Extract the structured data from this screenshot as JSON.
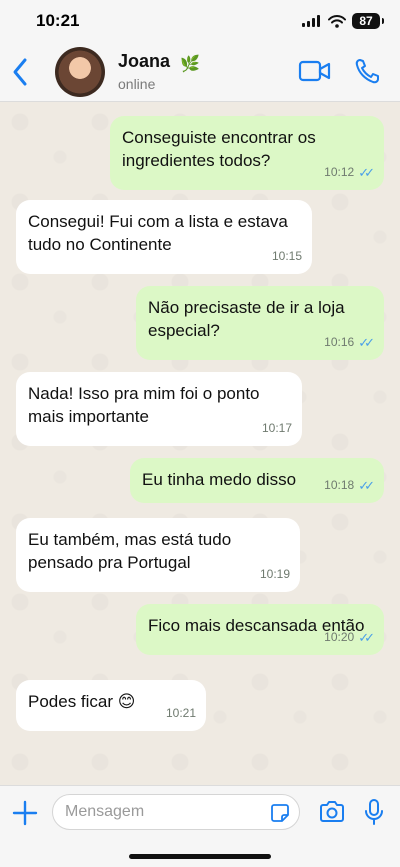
{
  "status_bar": {
    "time": "10:21",
    "battery": "87"
  },
  "header": {
    "contact_name": "Joana",
    "contact_status": "online",
    "name_emoji": "🌿"
  },
  "messages": [
    {
      "direction": "out",
      "text": "Conseguiste encontrar os ingredientes todos?",
      "time": "10:12",
      "read": true
    },
    {
      "direction": "in",
      "text": "Consegui! Fui com a lista e estava tudo no Continente",
      "time": "10:15"
    },
    {
      "direction": "out",
      "text": "Não precisaste de ir a loja especial?",
      "time": "10:16",
      "read": true
    },
    {
      "direction": "in",
      "text": "Nada! Isso pra mim foi o ponto mais importante",
      "time": "10:17"
    },
    {
      "direction": "out",
      "text": "Eu tinha medo disso",
      "time": "10:18",
      "read": true
    },
    {
      "direction": "in",
      "text": "Eu também, mas está tudo pensado pra Portugal",
      "time": "10:19"
    },
    {
      "direction": "out",
      "text": "Fico mais descansada então",
      "time": "10:20",
      "read": true
    },
    {
      "direction": "in",
      "text": "Podes ficar 😊",
      "time": "10:21"
    }
  ],
  "input": {
    "placeholder": "Mensagem"
  },
  "colors": {
    "accent": "#1a7ef0",
    "outgoing_bubble": "#dcf8c6",
    "incoming_bubble": "#ffffff",
    "chat_bg": "#efeae2",
    "read_ticks": "#4a9fe8"
  }
}
